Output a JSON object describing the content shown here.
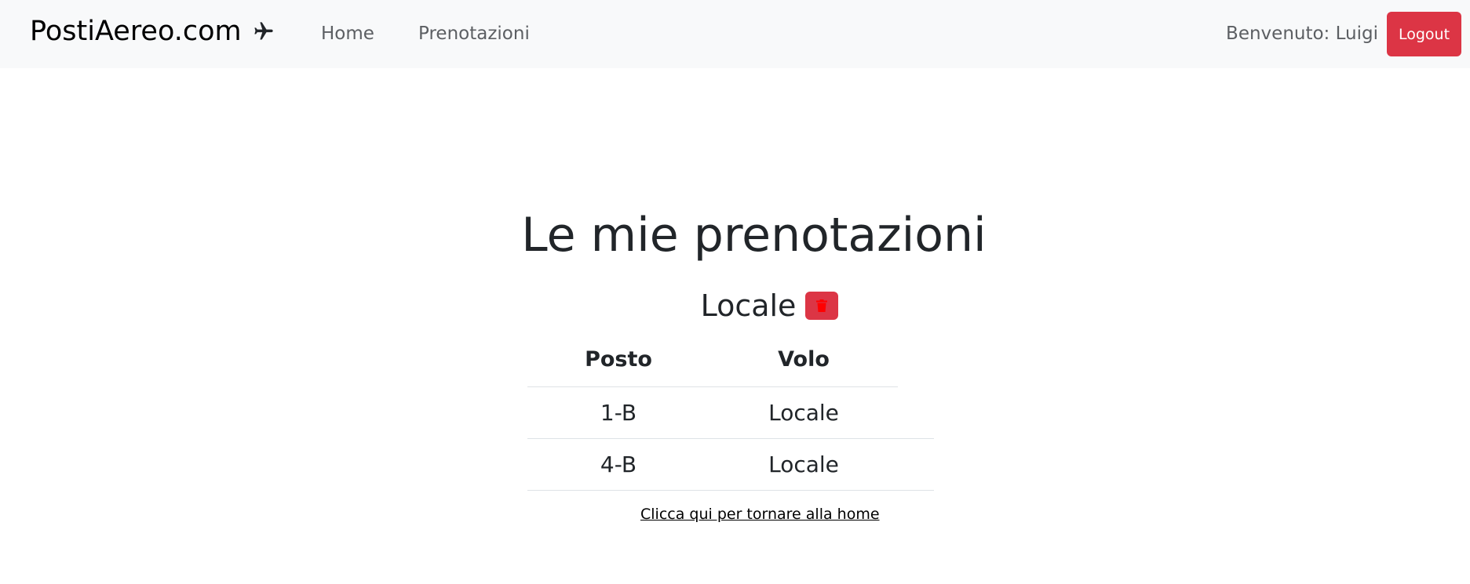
{
  "navbar": {
    "brand": "PostiAereo.com",
    "brand_icon": "airplane-icon",
    "links": [
      {
        "label": "Home"
      },
      {
        "label": "Prenotazioni"
      }
    ],
    "welcome": "Benvenuto: Luigi",
    "logout_label": "Logout"
  },
  "main": {
    "title": "Le mie prenotazioni",
    "section": {
      "title": "Locale",
      "delete_icon": "trash-icon",
      "table": {
        "headers": [
          "Posto",
          "Volo"
        ],
        "rows": [
          [
            "1-B",
            "Locale"
          ],
          [
            "4-B",
            "Locale"
          ]
        ]
      }
    },
    "home_link": "Clicca qui per tornare alla home"
  },
  "colors": {
    "navbar_bg": "#f8f9fa",
    "danger": "#dc3545",
    "trash_icon": "#ff0000",
    "text": "#212529"
  }
}
